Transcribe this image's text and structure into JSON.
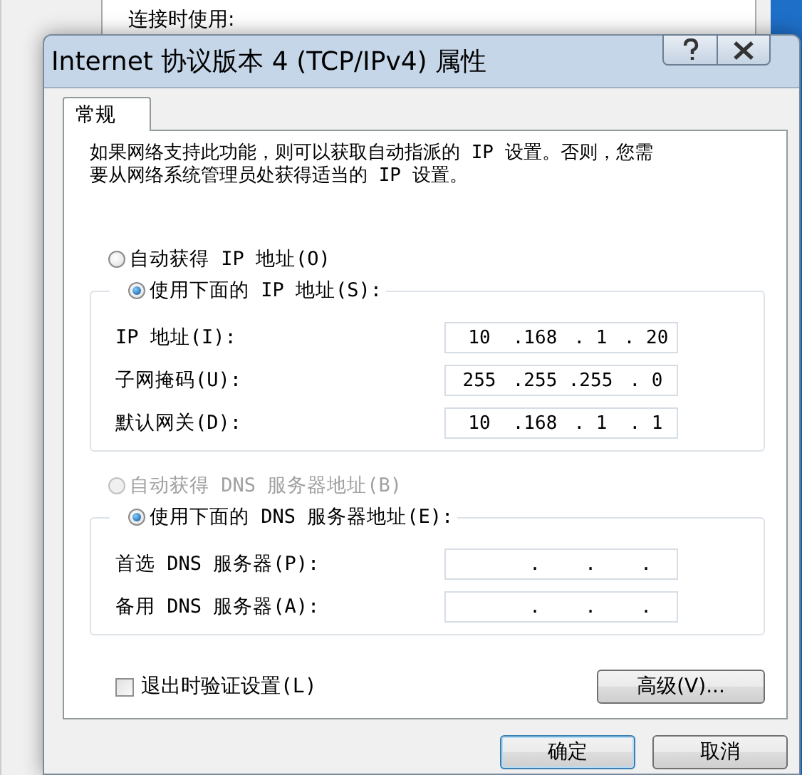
{
  "background_window": {
    "label": "连接时使用:"
  },
  "dialog": {
    "title": "Internet 协议版本 4 (TCP/IPv4) 属性"
  },
  "tabs": [
    {
      "label": "常规",
      "selected": true
    }
  ],
  "description_lines": [
    "如果网络支持此功能，则可以获取自动指派的 IP 设置。否则，您需",
    "要从网络系统管理员处获得适当的 IP 设置。"
  ],
  "ip_mode": [
    {
      "label": "自动获得 IP 地址(O)",
      "selected": false,
      "disabled": false
    },
    {
      "label": "使用下面的 IP 地址(S):",
      "selected": true,
      "disabled": false
    }
  ],
  "ip_fields": [
    {
      "label": "IP 地址(I):",
      "segments": [
        "10",
        ".168",
        ". 1",
        ". 20"
      ]
    },
    {
      "label": "子网掩码(U):",
      "segments": [
        "255",
        ".255",
        ".255",
        ". 0"
      ]
    },
    {
      "label": "默认网关(D):",
      "segments": [
        "10",
        ".168",
        ". 1",
        ". 1"
      ]
    }
  ],
  "dns_mode": [
    {
      "label": "自动获得 DNS 服务器地址(B)",
      "selected": false,
      "disabled": true
    },
    {
      "label": "使用下面的 DNS 服务器地址(E):",
      "selected": true,
      "disabled": false
    }
  ],
  "dns_fields": [
    {
      "label": "首选 DNS 服务器(P):",
      "segments": [
        ".",
        ".",
        "."
      ]
    },
    {
      "label": "备用 DNS 服务器(A):",
      "segments": [
        ".",
        ".",
        "."
      ]
    }
  ],
  "verify_on_exit": {
    "label": "退出时验证设置(L)",
    "checked": false
  },
  "advanced_button": "高级(V)...",
  "buttons": [
    {
      "kind": "ok",
      "label": "确定"
    },
    {
      "kind": "cancel",
      "label": "取消"
    }
  ]
}
